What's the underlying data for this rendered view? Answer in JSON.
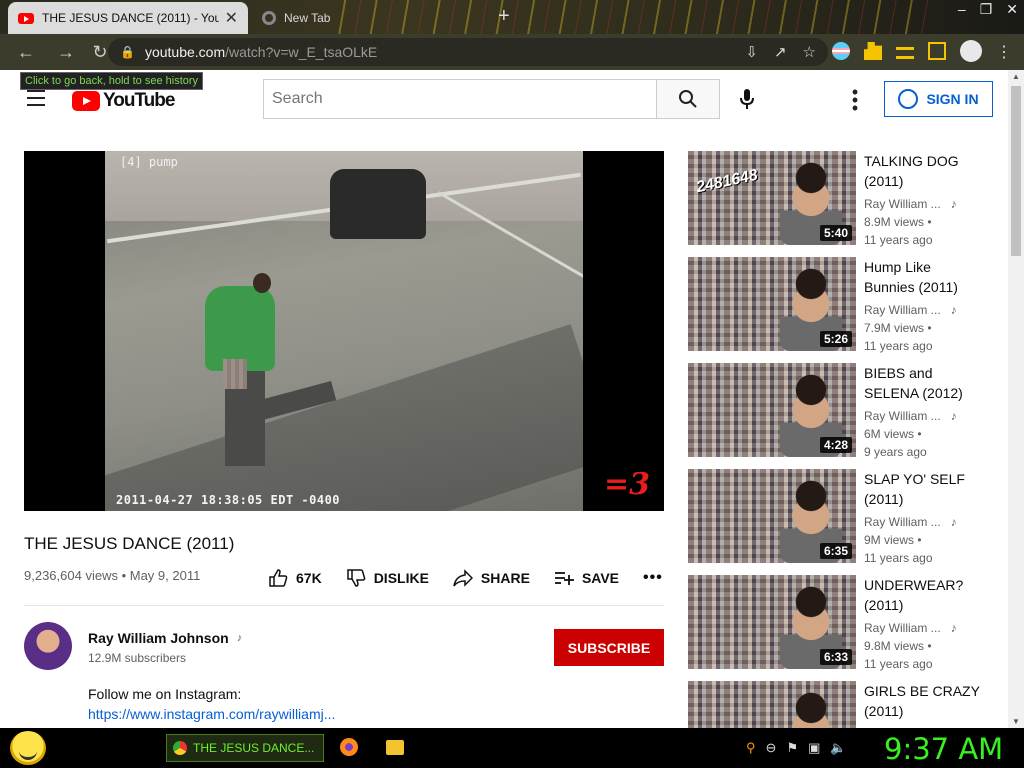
{
  "browser": {
    "tabs": [
      {
        "title": "THE JESUS DANCE (2011) - YouTube",
        "active": true
      },
      {
        "title": "New Tab",
        "active": false
      }
    ],
    "url_host": "youtube.com",
    "url_path": "/watch?v=w_E_tsaOLkE",
    "tooltip": "Click to go back, hold to see history"
  },
  "header": {
    "logo_text": "YouTube",
    "search_placeholder": "Search",
    "signin_label": "SIGN IN"
  },
  "video": {
    "camera_label": "[4] pump",
    "timestamp": "2011-04-27 18:38:05 EDT -0400",
    "watermark": "=3",
    "title": "THE JESUS DANCE (2011)",
    "views": "9,236,604 views",
    "date": "May 9, 2011",
    "likes": "67K",
    "dislike_label": "DISLIKE",
    "share_label": "SHARE",
    "save_label": "SAVE",
    "more_label": "•••"
  },
  "channel": {
    "name": "Ray William Johnson",
    "subscribers": "12.9M subscribers",
    "subscribe_label": "SUBSCRIBE",
    "description_line1": "Follow me on Instagram:",
    "description_link": "https://www.instagram.com/raywilliamj..."
  },
  "recommendations": [
    {
      "title": "TALKING DOG (2011)",
      "channel": "Ray William ...",
      "views": "8.9M views •",
      "age": "11 years ago",
      "duration": "5:40",
      "badge": "2481648"
    },
    {
      "title": "Hump Like Bunnies (2011)",
      "channel": "Ray William ...",
      "views": "7.9M views •",
      "age": "11 years ago",
      "duration": "5:26"
    },
    {
      "title": "BIEBS and SELENA (2012)",
      "channel": "Ray William ...",
      "views": "6M views •",
      "age": "9 years ago",
      "duration": "4:28"
    },
    {
      "title": "SLAP YO' SELF (2011)",
      "channel": "Ray William ...",
      "views": "9M views •",
      "age": "11 years ago",
      "duration": "6:35"
    },
    {
      "title": "UNDERWEAR? (2011)",
      "channel": "Ray William ...",
      "views": "9.8M views •",
      "age": "11 years ago",
      "duration": "6:33"
    },
    {
      "title": "GIRLS BE CRAZY (2011)",
      "channel": "",
      "views": "",
      "age": "",
      "duration": ""
    }
  ],
  "taskbar": {
    "active_task": "THE JESUS DANCE...",
    "clock": "9:37 AM"
  },
  "icons": {
    "note": "♪"
  }
}
